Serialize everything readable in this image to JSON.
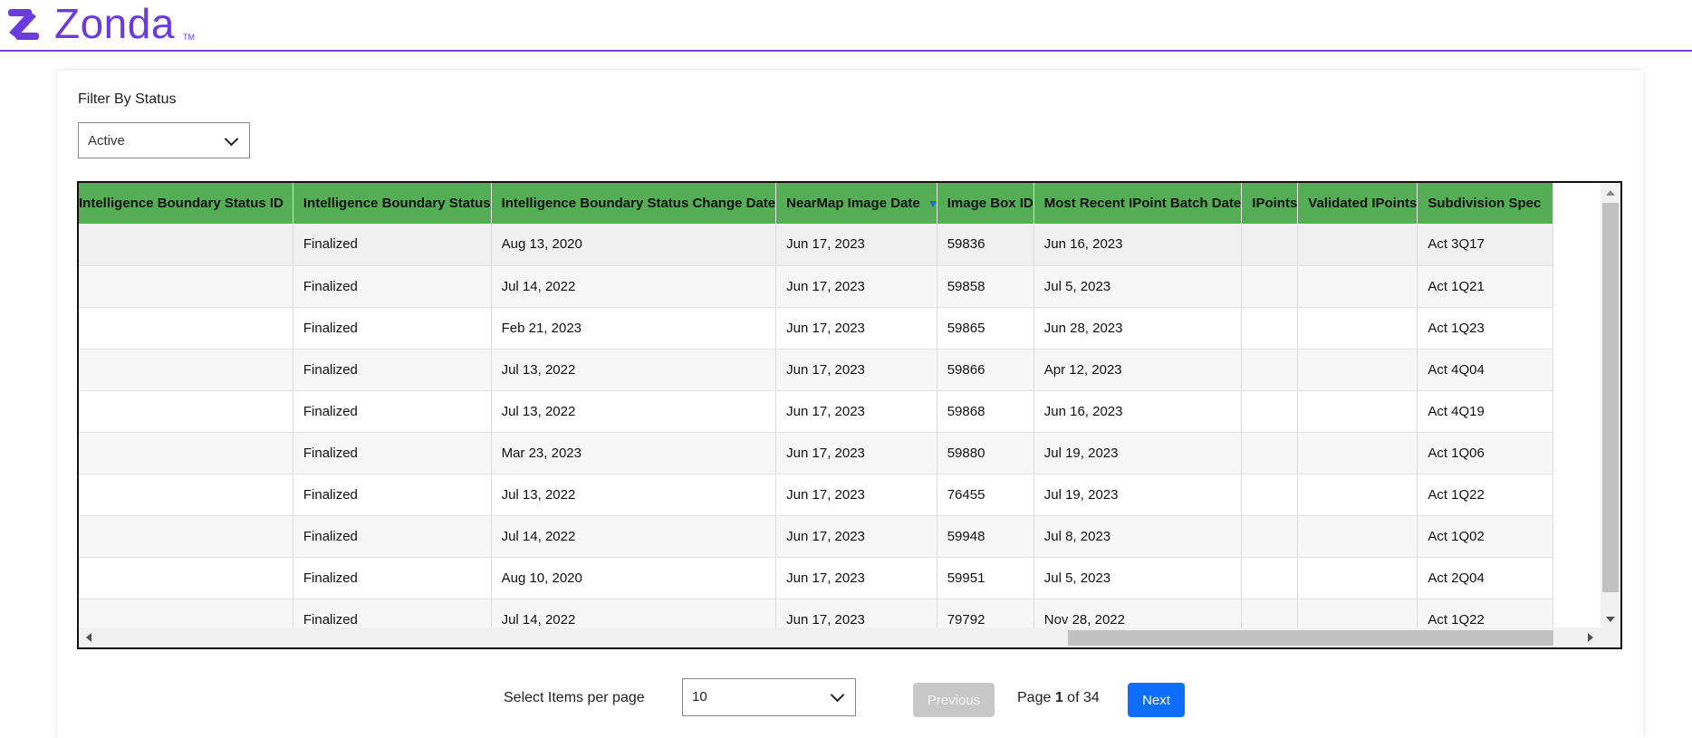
{
  "brand": {
    "name": "Zonda",
    "tm": "TM",
    "color": "#6a3ce0"
  },
  "filter": {
    "label": "Filter By Status",
    "selected": "Active"
  },
  "table": {
    "columns": [
      {
        "label": "Intelligence Boundary Status ID"
      },
      {
        "label": "Intelligence Boundary Status"
      },
      {
        "label": "Intelligence Boundary Status Change Date"
      },
      {
        "label": "NearMap Image Date",
        "sorted": "desc"
      },
      {
        "label": "Image Box ID"
      },
      {
        "label": "Most Recent IPoint Batch Date"
      },
      {
        "label": "IPoints"
      },
      {
        "label": "Validated IPoints"
      },
      {
        "label": "Subdivision Spec"
      }
    ],
    "rows": [
      [
        "",
        "Finalized",
        "Aug 13, 2020",
        "Jun 17, 2023",
        "59836",
        "Jun 16, 2023",
        "",
        "",
        "Act 3Q17"
      ],
      [
        "",
        "Finalized",
        "Jul 14, 2022",
        "Jun 17, 2023",
        "59858",
        "Jul 5, 2023",
        "",
        "",
        "Act 1Q21"
      ],
      [
        "",
        "Finalized",
        "Feb 21, 2023",
        "Jun 17, 2023",
        "59865",
        "Jun 28, 2023",
        "",
        "",
        "Act 1Q23"
      ],
      [
        "",
        "Finalized",
        "Jul 13, 2022",
        "Jun 17, 2023",
        "59866",
        "Apr 12, 2023",
        "",
        "",
        "Act 4Q04"
      ],
      [
        "",
        "Finalized",
        "Jul 13, 2022",
        "Jun 17, 2023",
        "59868",
        "Jun 16, 2023",
        "",
        "",
        "Act 4Q19"
      ],
      [
        "",
        "Finalized",
        "Mar 23, 2023",
        "Jun 17, 2023",
        "59880",
        "Jul 19, 2023",
        "",
        "",
        "Act 1Q06"
      ],
      [
        "",
        "Finalized",
        "Jul 13, 2022",
        "Jun 17, 2023",
        "76455",
        "Jul 19, 2023",
        "",
        "",
        "Act 1Q22"
      ],
      [
        "",
        "Finalized",
        "Jul 14, 2022",
        "Jun 17, 2023",
        "59948",
        "Jul 8, 2023",
        "",
        "",
        "Act 1Q02"
      ],
      [
        "",
        "Finalized",
        "Aug 10, 2020",
        "Jun 17, 2023",
        "59951",
        "Jul 5, 2023",
        "",
        "",
        "Act 2Q04"
      ],
      [
        "",
        "Finalized",
        "Jul 14, 2022",
        "Jun 17, 2023",
        "79792",
        "Nov 28, 2022",
        "",
        "",
        "Act 1Q22"
      ]
    ]
  },
  "pagination": {
    "per_page_label": "Select Items per page",
    "per_page_value": "10",
    "prev_label": "Previous",
    "page_prefix": "Page ",
    "page_current": "1",
    "page_of": " of ",
    "page_total": "34",
    "next_label": "Next"
  },
  "icons": {
    "logo": "zonda-logo-icon",
    "sort": "sort-desc-icon",
    "select": "chevron-down-icon"
  },
  "colors": {
    "header_green": "#55ad55",
    "accent_purple": "#7b3fe4",
    "next_blue": "#0d6efd"
  }
}
